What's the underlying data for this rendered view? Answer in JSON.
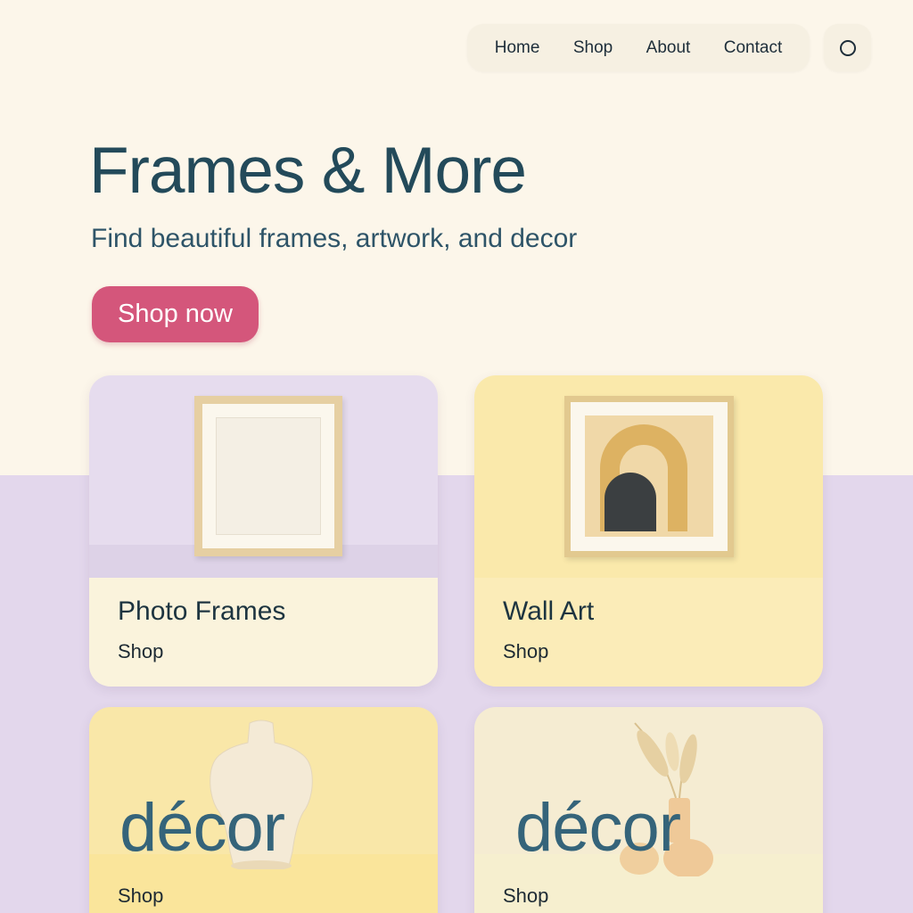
{
  "nav": {
    "items": [
      "Home",
      "Shop",
      "About",
      "Contact"
    ]
  },
  "hero": {
    "title": "Frames & More",
    "subtitle": "Find beautiful frames, artwork, and decor",
    "cta_label": "Shop now"
  },
  "cards": [
    {
      "title": "Photo Frames",
      "link": "Shop"
    },
    {
      "title": "Wall Art",
      "link": "Shop"
    },
    {
      "overlay": "décor",
      "link": "Shop"
    },
    {
      "overlay": "décor",
      "link": "Shop"
    }
  ],
  "icons": {
    "account": "circle-icon"
  },
  "colors": {
    "background_top": "#fcf6ea",
    "background_bottom": "#e3d7ec",
    "heading": "#234a5a",
    "cta": "#d4567b"
  }
}
